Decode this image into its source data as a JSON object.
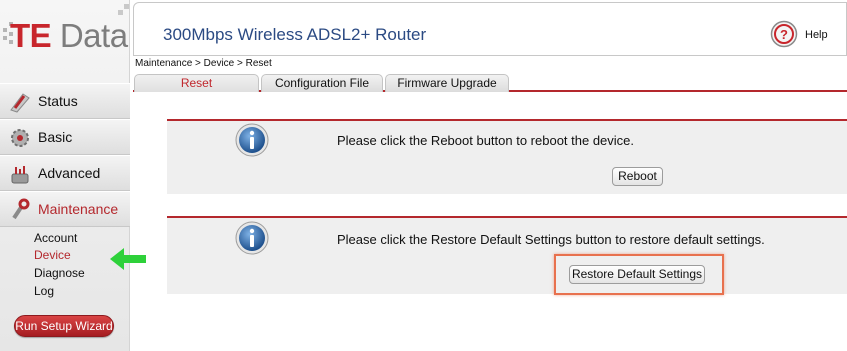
{
  "brand": {
    "te": "TE",
    "data": "Data"
  },
  "header": {
    "title": "300Mbps Wireless ADSL2+ Router",
    "help_label": "Help"
  },
  "breadcrumb": "Maintenance > Device > Reset",
  "nav": [
    {
      "label": "Status",
      "icon": "status-icon"
    },
    {
      "label": "Basic",
      "icon": "basic-icon"
    },
    {
      "label": "Advanced",
      "icon": "advanced-icon"
    },
    {
      "label": "Maintenance",
      "icon": "maintenance-icon",
      "active": true
    }
  ],
  "subnav": [
    {
      "label": "Account"
    },
    {
      "label": "Device",
      "active": true
    },
    {
      "label": "Diagnose"
    },
    {
      "label": "Log"
    }
  ],
  "wizard_label": "Run Setup Wizard",
  "tabs": [
    {
      "label": "Reset",
      "active": true
    },
    {
      "label": "Configuration File"
    },
    {
      "label": "Firmware Upgrade"
    }
  ],
  "panels": {
    "reboot": {
      "message": "Please click the Reboot button to reboot the device.",
      "button": "Reboot"
    },
    "restore": {
      "message": "Please click the Restore Default Settings button to restore default settings.",
      "button": "Restore Default Settings"
    }
  },
  "colors": {
    "accent": "#b4282d",
    "title": "#2b4a83",
    "arrow": "#2ed13a",
    "highlight": "#e8714e"
  }
}
